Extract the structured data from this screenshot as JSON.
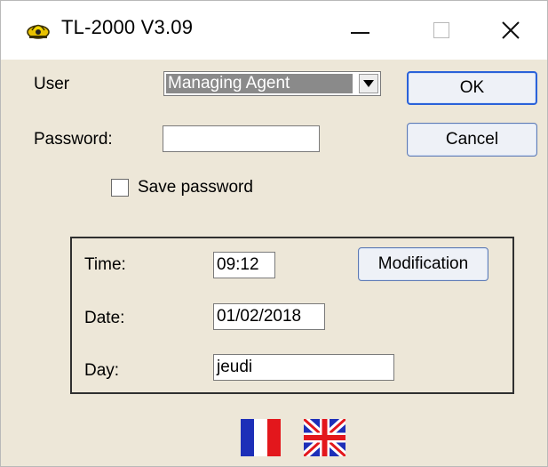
{
  "window": {
    "title": "TL-2000  V3.09",
    "icon": "app-icon"
  },
  "titlebar_controls": {
    "minimize": "minimize-icon",
    "maximize": "maximize-icon",
    "close": "close-icon"
  },
  "login": {
    "user_label": "User",
    "user_value": "Managing Agent",
    "password_label": "Password:",
    "password_value": "",
    "save_password_label": "Save password",
    "save_password_checked": false
  },
  "buttons": {
    "ok": "OK",
    "cancel": "Cancel",
    "modification": "Modification"
  },
  "datetime": {
    "time_label": "Time:",
    "time_value": "09:12",
    "date_label": "Date:",
    "date_value": "01/02/2018",
    "day_label": "Day:",
    "day_value": "jeudi"
  },
  "languages": [
    "french-flag-icon",
    "uk-flag-icon"
  ],
  "colors": {
    "window_bg": "#ede7d8",
    "titlebar_bg": "#ffffff",
    "ok_border": "#2b62d9",
    "combo_selection": "#8a8a8a"
  }
}
